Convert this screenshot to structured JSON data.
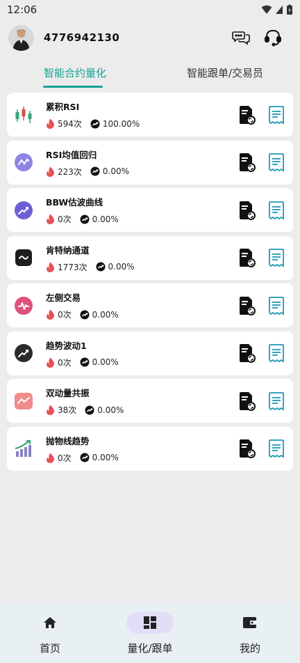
{
  "status_bar": {
    "time": "12:06"
  },
  "header": {
    "user_id": "4776942130"
  },
  "tabs": [
    {
      "label": "智能合约量化",
      "active": true
    },
    {
      "label": "智能跟单/交易员",
      "active": false
    }
  ],
  "strategies": [
    {
      "name": "累积RSI",
      "count": "594次",
      "rate": "100.00%",
      "icon": "candlestick-icon"
    },
    {
      "name": "RSI均值回归",
      "count": "223次",
      "rate": "0.00%",
      "icon": "wave-icon"
    },
    {
      "name": "BBW估波曲线",
      "count": "0次",
      "rate": "0.00%",
      "icon": "trend-up-icon"
    },
    {
      "name": "肯特纳通道",
      "count": "1773次",
      "rate": "0.00%",
      "icon": "tilde-icon"
    },
    {
      "name": "左侧交易",
      "count": "0次",
      "rate": "0.00%",
      "icon": "pulse-icon"
    },
    {
      "name": "趋势波动1",
      "count": "0次",
      "rate": "0.00%",
      "icon": "trend-up-dark-icon"
    },
    {
      "name": "双动量共振",
      "count": "38次",
      "rate": "0.00%",
      "icon": "trend-down-icon"
    },
    {
      "name": "抛物线趋势",
      "count": "0次",
      "rate": "0.00%",
      "icon": "bar-growth-icon"
    }
  ],
  "bottom_nav": [
    {
      "label": "首页",
      "icon": "home-icon",
      "active": false
    },
    {
      "label": "量化/跟单",
      "icon": "dashboard-icon",
      "active": true
    },
    {
      "label": "我的",
      "icon": "wallet-icon",
      "active": false
    }
  ],
  "colors": {
    "accent": "#15a394",
    "flame": "#e8515a",
    "nav_active_bg": "#e3def8"
  }
}
